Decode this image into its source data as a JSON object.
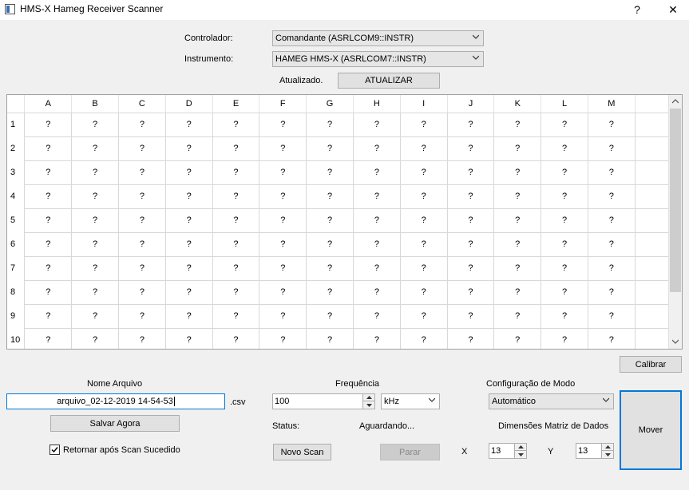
{
  "window": {
    "title": "HMS-X Hameg Receiver Scanner",
    "help_glyph": "?",
    "close_glyph": "✕"
  },
  "top": {
    "controlador_label": "Controlador:",
    "controlador_value": "Comandante (ASRLCOM9::INSTR)",
    "instrumento_label": "Instrumento:",
    "instrumento_value": "HAMEG HMS-X (ASRLCOM7::INSTR)",
    "atualizado_label": "Atualizado.",
    "atualizar_button": "ATUALIZAR"
  },
  "table": {
    "columns": [
      "A",
      "B",
      "C",
      "D",
      "E",
      "F",
      "G",
      "H",
      "I",
      "J",
      "K",
      "L",
      "M"
    ],
    "rows": [
      {
        "label": "1",
        "cells": [
          "?",
          "?",
          "?",
          "?",
          "?",
          "?",
          "?",
          "?",
          "?",
          "?",
          "?",
          "?",
          "?"
        ]
      },
      {
        "label": "2",
        "cells": [
          "?",
          "?",
          "?",
          "?",
          "?",
          "?",
          "?",
          "?",
          "?",
          "?",
          "?",
          "?",
          "?"
        ]
      },
      {
        "label": "3",
        "cells": [
          "?",
          "?",
          "?",
          "?",
          "?",
          "?",
          "?",
          "?",
          "?",
          "?",
          "?",
          "?",
          "?"
        ]
      },
      {
        "label": "4",
        "cells": [
          "?",
          "?",
          "?",
          "?",
          "?",
          "?",
          "?",
          "?",
          "?",
          "?",
          "?",
          "?",
          "?"
        ]
      },
      {
        "label": "5",
        "cells": [
          "?",
          "?",
          "?",
          "?",
          "?",
          "?",
          "?",
          "?",
          "?",
          "?",
          "?",
          "?",
          "?"
        ]
      },
      {
        "label": "6",
        "cells": [
          "?",
          "?",
          "?",
          "?",
          "?",
          "?",
          "?",
          "?",
          "?",
          "?",
          "?",
          "?",
          "?"
        ]
      },
      {
        "label": "7",
        "cells": [
          "?",
          "?",
          "?",
          "?",
          "?",
          "?",
          "?",
          "?",
          "?",
          "?",
          "?",
          "?",
          "?"
        ]
      },
      {
        "label": "8",
        "cells": [
          "?",
          "?",
          "?",
          "?",
          "?",
          "?",
          "?",
          "?",
          "?",
          "?",
          "?",
          "?",
          "?"
        ]
      },
      {
        "label": "9",
        "cells": [
          "?",
          "?",
          "?",
          "?",
          "?",
          "?",
          "?",
          "?",
          "?",
          "?",
          "?",
          "?",
          "?"
        ]
      },
      {
        "label": "10",
        "cells": [
          "?",
          "?",
          "?",
          "?",
          "?",
          "?",
          "?",
          "?",
          "?",
          "?",
          "?",
          "?",
          "?"
        ]
      }
    ]
  },
  "calibrar_button": "Calibrar",
  "file": {
    "nome_label": "Nome Arquivo",
    "filename": "arquivo_02-12-2019 14-54-53",
    "ext": ".csv",
    "salvar_button": "Salvar Agora",
    "retornar_label": "Retornar após Scan Sucedido",
    "retornar_checked": true
  },
  "freq": {
    "label": "Frequência",
    "value": "100",
    "unit": "kHz",
    "status_label": "Status:",
    "status_value": "Aguardando...",
    "novo_scan_button": "Novo Scan",
    "parar_button": "Parar"
  },
  "mode": {
    "label": "Configuração de Modo",
    "value": "Automático",
    "dim_label": "Dimensões Matriz de Dados",
    "x_label": "X",
    "x_value": "13",
    "y_label": "Y",
    "y_value": "13",
    "mover_button": "Mover"
  }
}
